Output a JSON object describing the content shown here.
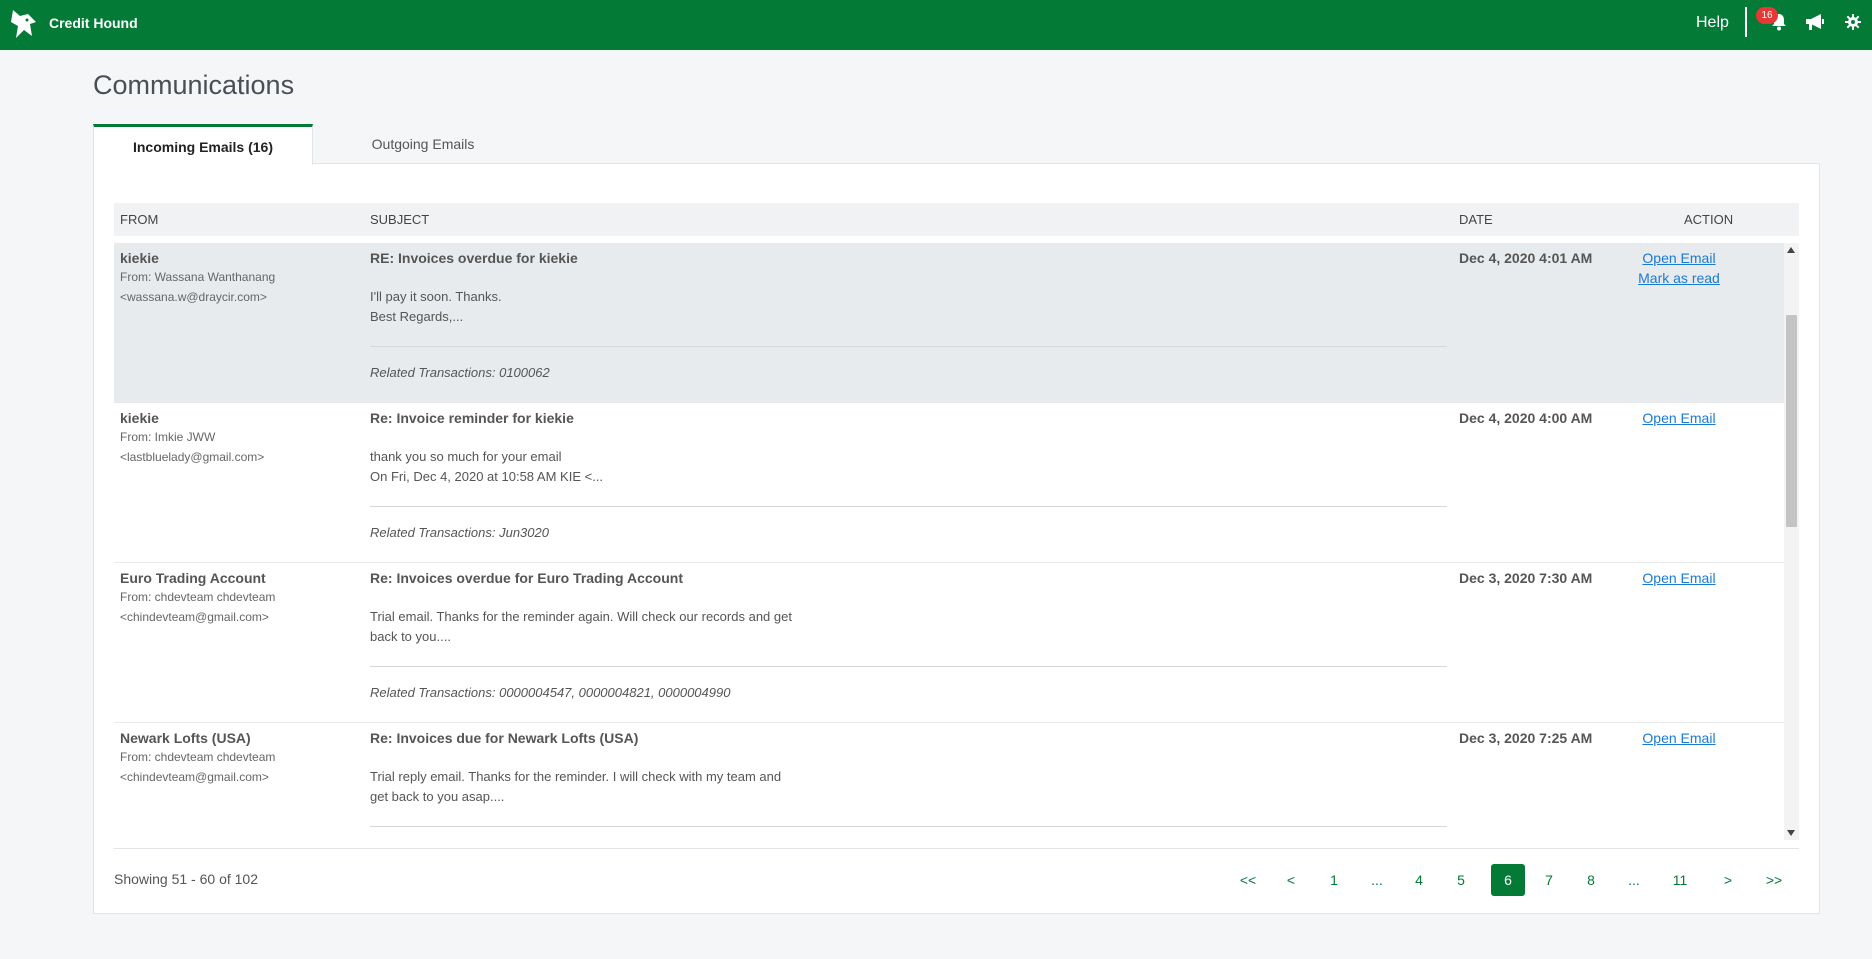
{
  "app": {
    "brand": "Credit Hound",
    "colors": {
      "primary": "#037a36",
      "badge": "#e53935",
      "link": "#1a7bd3"
    }
  },
  "topbar": {
    "help": "Help",
    "notification_count": "16",
    "icons": [
      "wolf-logo-icon",
      "bell-icon",
      "megaphone-icon",
      "gear-icon"
    ]
  },
  "page": {
    "title": "Communications"
  },
  "tabs": {
    "incoming": "Incoming Emails (16)",
    "outgoing": "Outgoing Emails"
  },
  "table": {
    "headers": {
      "from": "FROM",
      "subject": "SUBJECT",
      "date": "DATE",
      "action": "ACTION"
    },
    "rows": [
      {
        "name": "kiekie",
        "from_line1": "From: Wassana Wanthanang",
        "from_line2": "<wassana.w@draycir.com>",
        "subject": "RE: Invoices overdue for kiekie",
        "snippet_line1": "I'll pay it soon. Thanks.",
        "snippet_line2": "Best Regards,...",
        "related": "Related Transactions: 0100062",
        "date": "Dec 4, 2020 4:01 AM",
        "open": "Open Email",
        "mark": "Mark as read"
      },
      {
        "name": "kiekie",
        "from_line1": "From: Imkie JWW",
        "from_line2": "<lastbluelady@gmail.com>",
        "subject": "Re: Invoice reminder for kiekie",
        "snippet_line1": "thank you so much for your email",
        "snippet_line2": "On Fri, Dec 4, 2020 at 10:58 AM KIE <...",
        "related": "Related Transactions: Jun3020",
        "date": "Dec 4, 2020 4:00 AM",
        "open": "Open Email"
      },
      {
        "name": "Euro Trading Account",
        "from_line1": "From: chdevteam chdevteam",
        "from_line2": "<chindevteam@gmail.com>",
        "subject": "Re: Invoices overdue for Euro Trading Account",
        "snippet_line1": "Trial email. Thanks for the reminder again. Will check our records and get",
        "snippet_line2": "back to you....",
        "related": "Related Transactions: 0000004547, 0000004821, 0000004990",
        "date": "Dec 3, 2020 7:30 AM",
        "open": "Open Email"
      },
      {
        "name": "Newark Lofts (USA)",
        "from_line1": "From: chdevteam chdevteam",
        "from_line2": "<chindevteam@gmail.com>",
        "subject": "Re: Invoices due for Newark Lofts (USA)",
        "snippet_line1": "Trial reply email. Thanks for the reminder. I will check with my team and",
        "snippet_line2": "get back to you asap....",
        "date": "Dec 3, 2020 7:25 AM",
        "open": "Open Email"
      }
    ]
  },
  "footer": {
    "showing": "Showing  51 - 60  of  102"
  },
  "pagination": [
    "<<",
    "<",
    "1",
    "...",
    "4",
    "5",
    "6",
    "7",
    "8",
    "...",
    "11",
    ">",
    ">>"
  ],
  "pagination_active": "6"
}
